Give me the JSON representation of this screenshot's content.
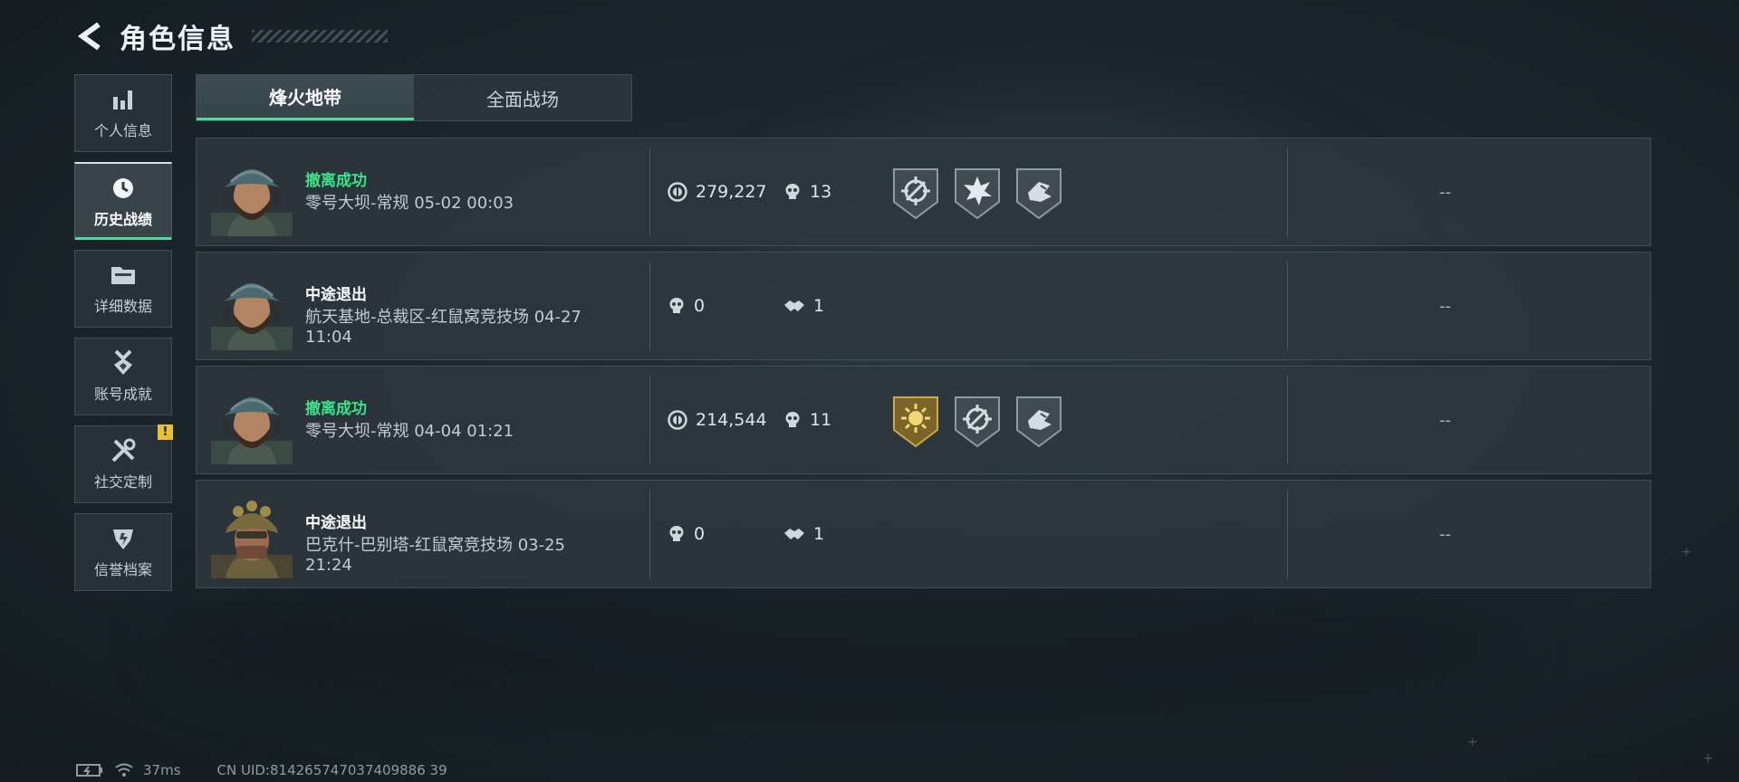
{
  "header": {
    "title": "角色信息"
  },
  "sidebar": {
    "items": [
      {
        "label": "个人信息",
        "icon": "bar-chart-icon"
      },
      {
        "label": "历史战绩",
        "icon": "clock-icon",
        "active": true
      },
      {
        "label": "详细数据",
        "icon": "folder-icon"
      },
      {
        "label": "账号成就",
        "icon": "medal-icon"
      },
      {
        "label": "社交定制",
        "icon": "tools-icon",
        "alert": "!"
      },
      {
        "label": "信誉档案",
        "icon": "credit-shield-icon"
      }
    ]
  },
  "tabs": [
    {
      "label": "烽火地带",
      "active": true
    },
    {
      "label": "全面战场"
    }
  ],
  "matches": [
    {
      "result": "撤离成功",
      "status": "success",
      "detail": "零号大坝-常规 05-02 00:03",
      "value": "279,227",
      "kills": "13",
      "medals": [
        "crosshair-medal",
        "burst-medal",
        "hand-medal"
      ],
      "score": "--"
    },
    {
      "result": "中途退出",
      "status": "quit",
      "detail": "航天基地-总裁区-红鼠窝竞技场 04-27 11:04",
      "kills": "0",
      "assists": "1",
      "score": "--"
    },
    {
      "result": "撤离成功",
      "status": "success",
      "detail": "零号大坝-常规 04-04 01:21",
      "value": "214,544",
      "kills": "11",
      "medals": [
        "gold-sun-medal",
        "crosshair-medal",
        "hand-medal"
      ],
      "score": "--"
    },
    {
      "result": "中途退出",
      "status": "quit",
      "detail": "巴克什-巴别塔-红鼠窝竞技场 03-25 21:24",
      "kills": "0",
      "assists": "1",
      "score": "--"
    }
  ],
  "status_bar": {
    "ping": "37ms",
    "uid": "CN UID:814265747037409886 39"
  },
  "colors": {
    "accent_green": "#43e09a",
    "success_text": "#3be489",
    "alert_yellow": "#e9c034"
  }
}
